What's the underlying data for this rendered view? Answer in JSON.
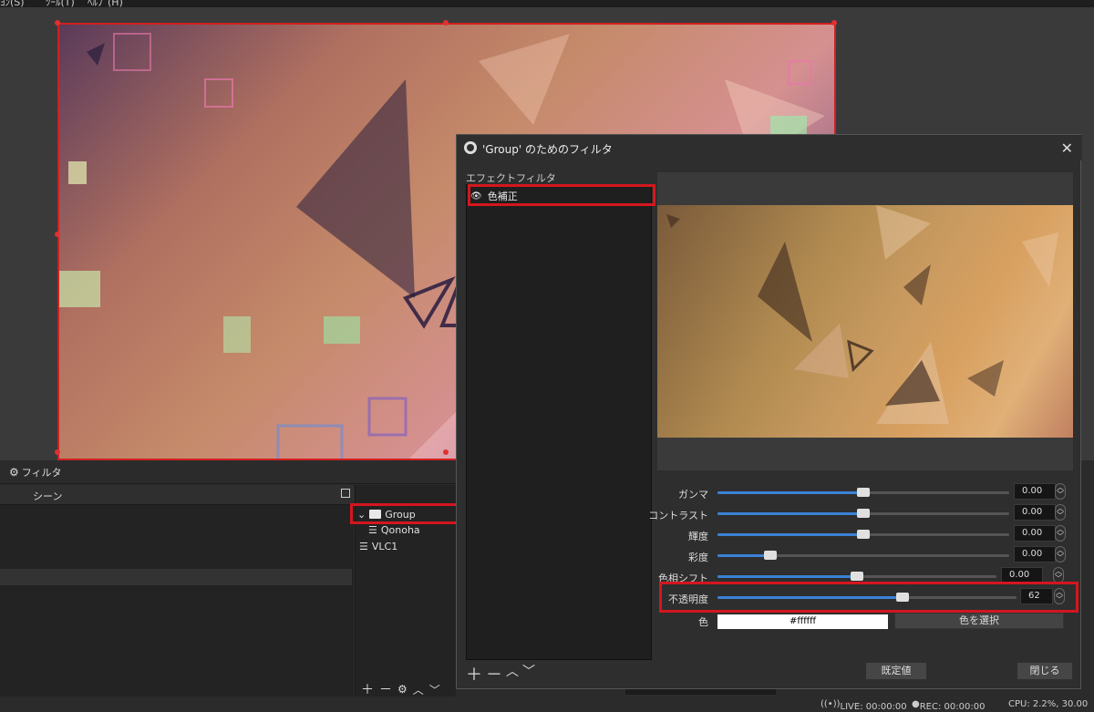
{
  "menu": {
    "items": [
      "ﾖﾝ(S)",
      "ﾂｰﾙ(T)",
      "ﾍﾙﾌﾟ(H)"
    ]
  },
  "docks": {
    "filters_tab": "フィルタ",
    "scene_header": "シーン"
  },
  "sources": {
    "items": [
      {
        "label": "Group",
        "icon": "folder-icon"
      },
      {
        "label": "Qonoha",
        "icon": "list-icon"
      },
      {
        "label": "VLC1",
        "icon": "list-icon"
      }
    ]
  },
  "dialog": {
    "title": "'Group' のためのフィルタ",
    "effect_filters_label": "エフェクトフィルタ",
    "filters": [
      {
        "label": "色補正",
        "icon": "eye-icon"
      }
    ],
    "properties": [
      {
        "label": "ガンマ",
        "value": "0.00",
        "level": 0.5
      },
      {
        "label": "コントラスト",
        "value": "0.00",
        "level": 0.5
      },
      {
        "label": "輝度",
        "value": "0.00",
        "level": 0.5
      },
      {
        "label": "彩度",
        "value": "0.00",
        "level": 0.17
      },
      {
        "label": "色相シフト",
        "value": "0.00",
        "level": 0.5
      },
      {
        "label": "不透明度",
        "value": "62",
        "level": 0.62
      }
    ],
    "color_label": "色",
    "color_value": "#ffffff",
    "select_color_button": "色を選択",
    "defaults_button": "既定値",
    "close_button": "閉じる"
  },
  "status": {
    "live": "LIVE: 00:00:00",
    "rec": "REC: 00:00:00",
    "cpu": "CPU: 2.2%, 30.00"
  },
  "colors": {
    "accent": "#3b82d6",
    "highlight": "#d4161e"
  }
}
